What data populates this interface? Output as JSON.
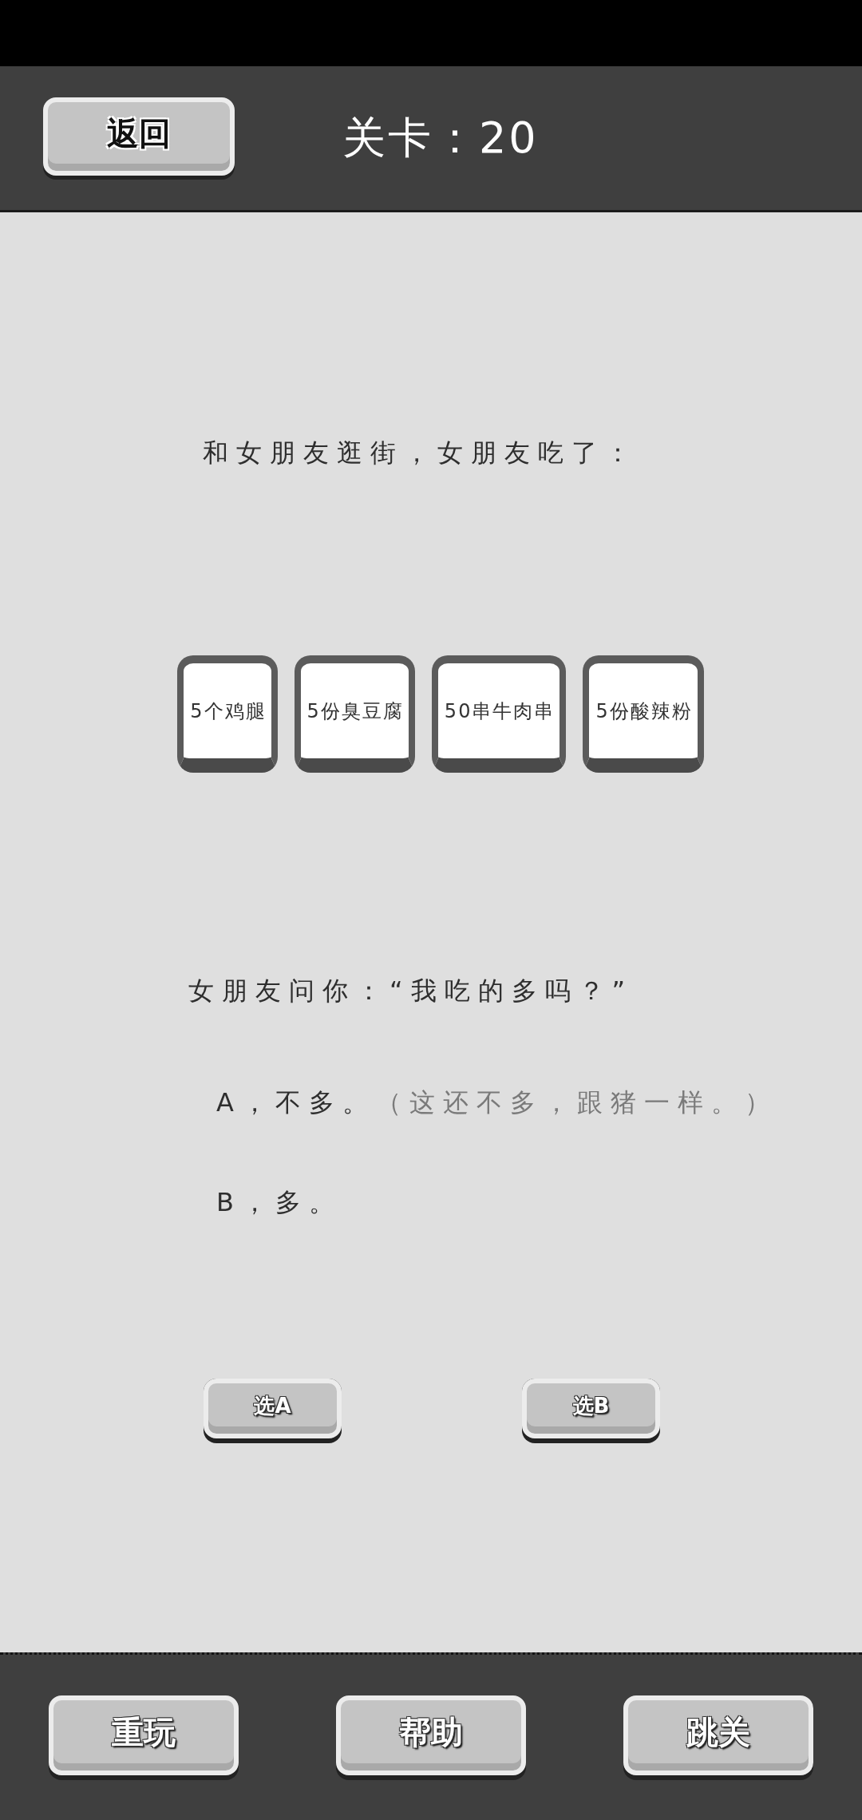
{
  "top_bar": {
    "back_button": "返回",
    "level_title": "关卡：20"
  },
  "puzzle": {
    "prompt": "和女朋友逛街，女朋友吃了：",
    "food_cards": [
      "5个鸡腿",
      "5份臭豆腐",
      "50串牛肉串",
      "5份酸辣粉"
    ],
    "question": "女朋友问你：“我吃的多吗？”",
    "options": [
      {
        "text": "A，不多。",
        "note": "（这还不多，跟猪一样。）"
      },
      {
        "text": "B，多。"
      }
    ],
    "answer_buttons": [
      "选A",
      "选B"
    ]
  },
  "bottom_bar": {
    "buttons": [
      "重玩",
      "帮助",
      "跳关"
    ]
  }
}
